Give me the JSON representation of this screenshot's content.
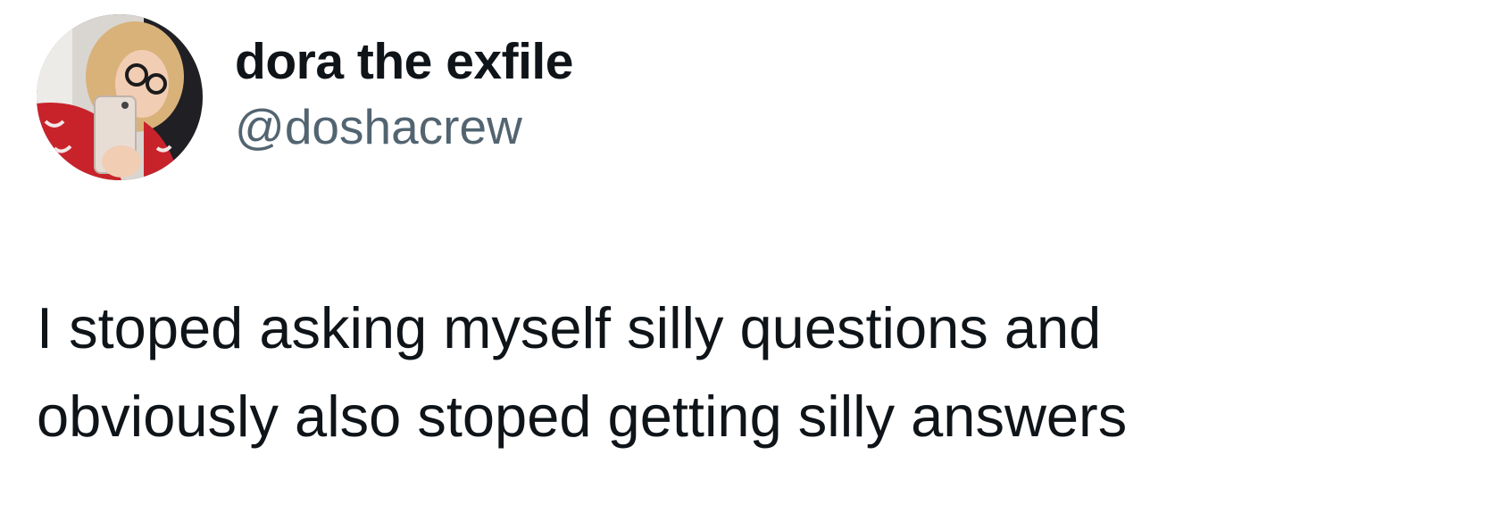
{
  "tweet": {
    "author": {
      "display_name": "dora the exfile",
      "handle": "@doshacrew",
      "avatar_icon": "profile-photo"
    },
    "text_lines": [
      "I stoped asking myself silly questions and",
      "obviously also stoped getting silly answers"
    ]
  },
  "colors": {
    "background": "#ffffff",
    "text_primary": "#0f1419",
    "text_secondary": "#536471"
  }
}
